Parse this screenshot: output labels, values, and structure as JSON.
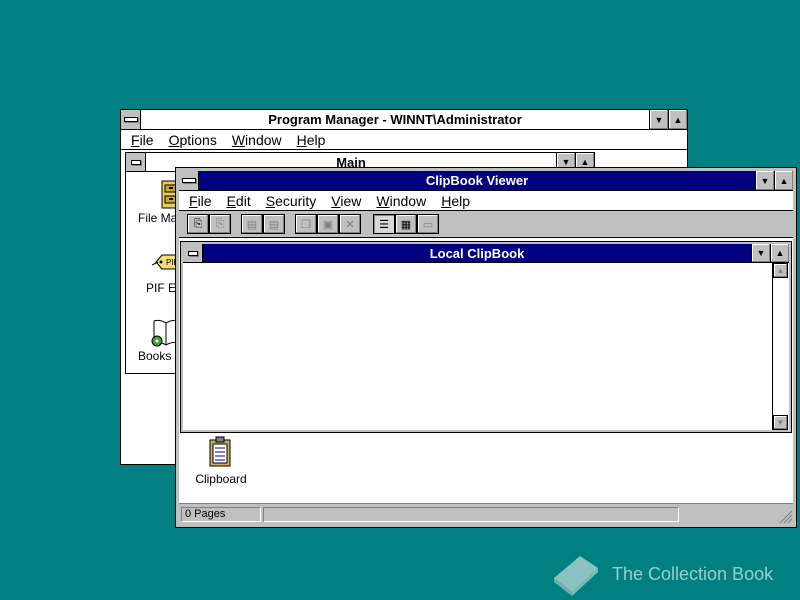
{
  "program_manager": {
    "title": "Program Manager - WINNT\\Administrator",
    "menu": [
      "File",
      "Options",
      "Window",
      "Help"
    ],
    "main_group": {
      "title": "Main",
      "icons": [
        {
          "label": "File Man",
          "icon": "file-manager-icon"
        },
        {
          "label": "PIF Ed",
          "icon": "pif-editor-icon"
        },
        {
          "label": "Books O",
          "icon": "books-online-icon"
        }
      ]
    }
  },
  "clipbook": {
    "title": "ClipBook Viewer",
    "menu": [
      "File",
      "Edit",
      "Security",
      "View",
      "Window",
      "Help"
    ],
    "toolbar_icons": [
      "connect-icon",
      "disconnect-icon",
      "share-icon",
      "stop-sharing-icon",
      "copy-icon",
      "paste-icon",
      "delete-icon",
      "table-of-contents-icon",
      "thumbnails-icon",
      "full-page-icon"
    ],
    "local_clipbook": {
      "title": "Local ClipBook"
    },
    "clipboard_icon_label": "Clipboard",
    "status": {
      "pages": "0 Pages"
    }
  },
  "watermark": {
    "text": "The Collection Book",
    "icon": "book-icon"
  },
  "colors": {
    "desktop": "#008080",
    "active_title": "#000080",
    "chrome": "#c0c0c0"
  }
}
